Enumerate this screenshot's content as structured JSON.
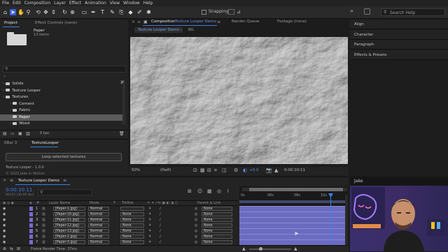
{
  "menu": [
    "File",
    "Edit",
    "Composition",
    "Layer",
    "Effect",
    "Animation",
    "View",
    "Window",
    "Help"
  ],
  "toolbar": {
    "snapping_label": "Snapping",
    "search_placeholder": "Search Help"
  },
  "project": {
    "tab_project": "Project",
    "tab_effect_controls": "Effect Controls (none)",
    "preview_name": "Paper",
    "preview_info": "13 items",
    "search_icon": "search-icon",
    "tree": [
      {
        "label": "Solids",
        "indent": 0,
        "selected": false
      },
      {
        "label": "Texture Looper",
        "indent": 0,
        "selected": false
      },
      {
        "label": "Textures",
        "indent": 0,
        "selected": false
      },
      {
        "label": "Cement",
        "indent": 1,
        "selected": false
      },
      {
        "label": "Fabric",
        "indent": 1,
        "selected": false
      },
      {
        "label": "Paper",
        "indent": 1,
        "selected": true
      },
      {
        "label": "Wood",
        "indent": 1,
        "selected": false
      }
    ],
    "bpc": "8 bpc"
  },
  "script_panel": {
    "tab_kbar": "KBar 3",
    "tab_tl": "TextureLooper",
    "button": "Loop selected textures",
    "version": "Texture Looper - 1.0.0",
    "copyright": "© 2022 Jake in Motion"
  },
  "composition": {
    "title": "Composition",
    "comp_name": "Texture Looper Demo",
    "tab_render": "Render Queue",
    "tab_footage": "Footage (none)",
    "sub_tab_active": "Texture Looper Demo",
    "sub_tab_other": "BG",
    "zoom": "50%",
    "resolution": "(Half)",
    "exposure": "+0.0",
    "timecode": "0:00:10:11"
  },
  "right_panels": [
    "Align",
    "Character",
    "Paragraph",
    "Effects & Presets"
  ],
  "webcam_label": "Jake",
  "timeline": {
    "tab": "Texture Looper Demo",
    "timecode": "0:00:10:11",
    "fps": "00311 (30.00 fps)",
    "columns": {
      "layer_name": "Layer Name",
      "mode": "Mode",
      "t": "T",
      "trkmat": "TrkMat",
      "parent": "Parent & Link"
    },
    "layers": [
      {
        "num": "1",
        "name": "[Paper-1.jpg]",
        "mode": "Normal",
        "trkmat": "",
        "parent": "None"
      },
      {
        "num": "2",
        "name": "[Paper-10.jpg]",
        "mode": "Normal",
        "trkmat": "None",
        "parent": "None"
      },
      {
        "num": "3",
        "name": "[Paper-11.jpg]",
        "mode": "Normal",
        "trkmat": "None",
        "parent": "None"
      },
      {
        "num": "4",
        "name": "[Paper-12.jpg]",
        "mode": "Normal",
        "trkmat": "None",
        "parent": "None"
      },
      {
        "num": "5",
        "name": "[Paper-13.jpg]",
        "mode": "Normal",
        "trkmat": "None",
        "parent": "None"
      },
      {
        "num": "6",
        "name": "[Paper-2.jpg]",
        "mode": "Normal",
        "trkmat": "None",
        "parent": "None"
      },
      {
        "num": "7",
        "name": "[Paper-3.jpg]",
        "mode": "Normal",
        "trkmat": "None",
        "parent": "None"
      }
    ],
    "ruler": [
      "0s",
      "06s",
      "08s",
      "10s"
    ],
    "footer": "Frame Render Time: 37ms"
  }
}
